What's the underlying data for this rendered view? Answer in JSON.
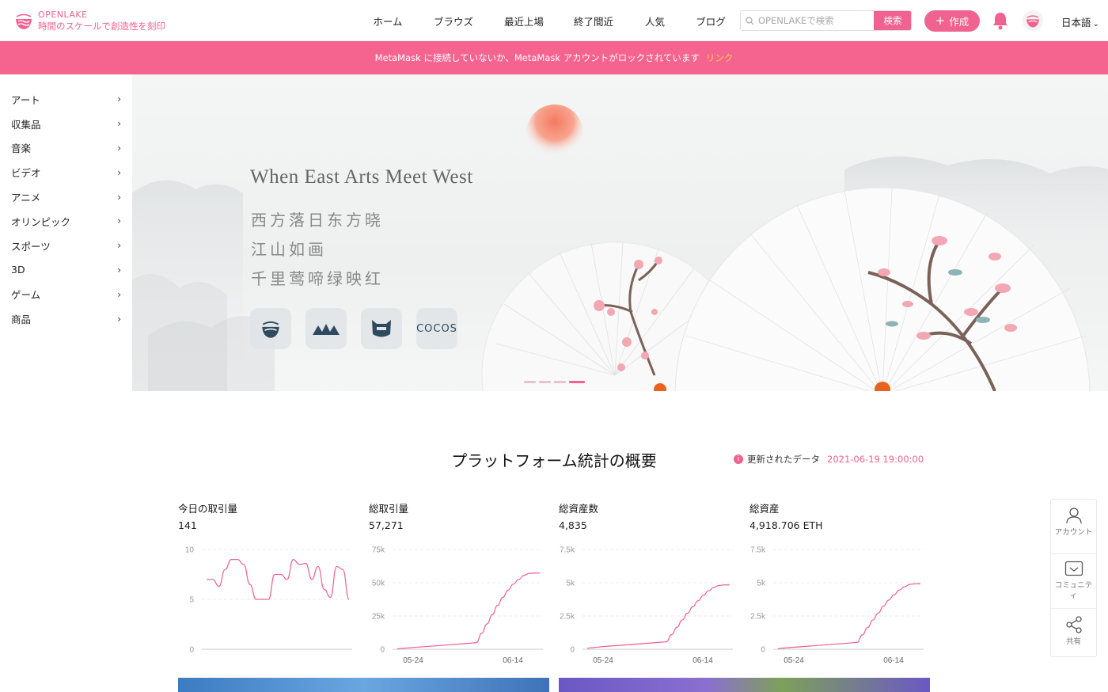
{
  "brand": {
    "name": "OPENLAKE",
    "tagline": "時間のスケールで創造性を刻印",
    "accent": "#f0628f"
  },
  "nav": {
    "items": [
      "ホーム",
      "ブラウズ",
      "最近上場",
      "終了間近",
      "人気",
      "ブログ"
    ]
  },
  "search": {
    "placeholder": "OPENLAKEで検索",
    "button": "検索"
  },
  "create_label": "作成",
  "language": "日本語",
  "notice": {
    "text": "MetaMask に接続していないか、MetaMask アカウントがロックされています",
    "link": "リンク"
  },
  "sidebar": {
    "items": [
      "アート",
      "収集品",
      "音楽",
      "ビデオ",
      "アニメ",
      "オリンピック",
      "スポーツ",
      "3D",
      "ゲーム",
      "商品"
    ]
  },
  "hero": {
    "title": "When East Arts Meet West",
    "lines": [
      "西方落日东方晓",
      "江山如画",
      "千里莺啼绿映红"
    ],
    "partners": [
      "openlake-logo-icon",
      "mountain-logo-icon",
      "helmet-logo-icon",
      "COCOS"
    ],
    "slides": 4,
    "active_slide": 4
  },
  "stats": {
    "title": "プラットフォーム統計の概要",
    "updated_label": "更新されたデータ",
    "updated_time": "2021-06-19 19:00:00",
    "cards": [
      {
        "label": "今日の取引量",
        "value": "141"
      },
      {
        "label": "総取引量",
        "value": "57,271"
      },
      {
        "label": "総資産数",
        "value": "4,835"
      },
      {
        "label": "総資産",
        "value": "4,918.706 ETH"
      }
    ]
  },
  "chart_data": [
    {
      "type": "line",
      "title": "今日の取引量",
      "x": [
        0,
        1,
        2,
        3,
        4,
        5,
        6,
        7,
        8,
        9,
        10,
        11,
        12,
        13,
        14,
        15,
        16,
        17,
        18,
        19,
        20,
        21,
        22,
        23
      ],
      "values": [
        7,
        7,
        6.3,
        8,
        9,
        9,
        8.5,
        6.5,
        5,
        5,
        5,
        7.5,
        7.5,
        7,
        9,
        8.5,
        8.6,
        7,
        8.3,
        6,
        5.2,
        8.3,
        8,
        5
      ],
      "yticks": [
        "0",
        "5",
        "10"
      ],
      "ylim": [
        0,
        10
      ],
      "xlabels": []
    },
    {
      "type": "line",
      "title": "総取引量",
      "x": [
        0,
        1,
        2,
        3,
        4,
        5,
        6,
        7,
        8,
        9,
        10,
        11,
        12,
        13,
        14,
        15,
        16,
        17,
        18,
        19,
        20,
        21,
        22,
        23,
        24,
        25,
        26,
        27
      ],
      "values": [
        300,
        700,
        1000,
        1300,
        1600,
        1900,
        2200,
        2500,
        2800,
        3100,
        3400,
        3700,
        4000,
        4300,
        4600,
        5000,
        12000,
        19000,
        26000,
        33000,
        39000,
        44500,
        49000,
        52500,
        55500,
        57000,
        57271,
        57271
      ],
      "yticks": [
        "0",
        "25k",
        "50k",
        "75k"
      ],
      "ylim": [
        0,
        75000
      ],
      "xlabels": [
        "05-24",
        "06-14"
      ]
    },
    {
      "type": "line",
      "title": "総資産数",
      "x": [
        0,
        1,
        2,
        3,
        4,
        5,
        6,
        7,
        8,
        9,
        10,
        11,
        12,
        13,
        14,
        15,
        16,
        17,
        18,
        19,
        20,
        21,
        22,
        23,
        24,
        25,
        26,
        27
      ],
      "values": [
        80,
        120,
        160,
        200,
        230,
        260,
        290,
        320,
        350,
        380,
        410,
        440,
        470,
        500,
        530,
        560,
        1100,
        1650,
        2200,
        2700,
        3200,
        3650,
        4050,
        4400,
        4650,
        4800,
        4835,
        4835
      ],
      "yticks": [
        "0",
        "2.5k",
        "5k",
        "7.5k"
      ],
      "ylim": [
        0,
        7500
      ],
      "xlabels": [
        "05-24",
        "06-14"
      ]
    },
    {
      "type": "line",
      "title": "総資産",
      "x": [
        0,
        1,
        2,
        3,
        4,
        5,
        6,
        7,
        8,
        9,
        10,
        11,
        12,
        13,
        14,
        15,
        16,
        17,
        18,
        19,
        20,
        21,
        22,
        23,
        24,
        25,
        26,
        27
      ],
      "values": [
        50,
        90,
        120,
        150,
        180,
        210,
        240,
        270,
        300,
        330,
        360,
        390,
        420,
        450,
        480,
        520,
        1080,
        1640,
        2200,
        2720,
        3250,
        3700,
        4100,
        4450,
        4700,
        4880,
        4918,
        4918
      ],
      "yticks": [
        "0",
        "2.5k",
        "5k",
        "7.5k"
      ],
      "ylim": [
        0,
        7500
      ],
      "xlabels": [
        "05-24",
        "06-14"
      ]
    }
  ],
  "float_menu": [
    {
      "icon": "account-icon",
      "label": "アカウント"
    },
    {
      "icon": "community-icon",
      "label": "コミュニティ"
    },
    {
      "icon": "share-icon",
      "label": "共有"
    }
  ]
}
